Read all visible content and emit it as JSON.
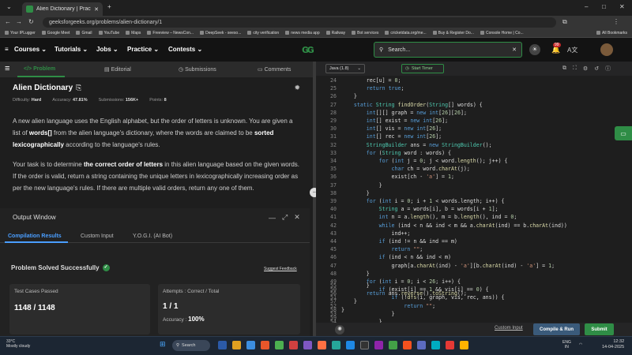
{
  "browser": {
    "tab_title": "Alien Dictionary | Practice | Gee...",
    "url": "geeksforgeeks.org/problems/alien-dictionary/1",
    "bookmarks": [
      "Your IPLugger",
      "Google Meet",
      "Gmail",
      "YouTube",
      "Maps",
      "Freeview – NewsCon...",
      "DeepSeek - seeso...",
      "city verification",
      "news media app",
      "Railway",
      "Bot services",
      "cricketdata.org/me...",
      "Buy & Register Do...",
      "Console Home | Co..."
    ],
    "all_bookmarks": "All Bookmarks"
  },
  "nav": {
    "items": [
      "Courses",
      "Tutorials",
      "Jobs",
      "Practice",
      "Contests"
    ],
    "search_placeholder": "Search...",
    "notif_count": "99"
  },
  "problem_tabs": [
    "Problem",
    "Editorial",
    "Submissions",
    "Comments"
  ],
  "problem": {
    "title": "Alien Dictionary",
    "difficulty_label": "Difficulty:",
    "difficulty": "Hard",
    "accuracy_label": "Accuracy:",
    "accuracy": "47.81%",
    "submissions_label": "Submissions:",
    "submissions": "156K+",
    "points_label": "Points:",
    "points": "8",
    "p1_a": "A new alien language uses the English alphabet, but the order of letters is unknown. You are given a list of ",
    "p1_b": "words[]",
    "p1_c": " from the alien language's dictionary, where the words are claimed to be ",
    "p1_d": "sorted lexicographically",
    "p1_e": " according to the language's rules.",
    "p2_a": "Your task is to determine ",
    "p2_b": "the correct order of letters",
    "p2_c": " in this alien language based on the given words. If the order is valid, return a string containing the unique letters in lexicographically increasing order as per the new language's rules. If there are multiple valid orders, return any one of them."
  },
  "output": {
    "title": "Output Window",
    "tabs": [
      "Compilation Results",
      "Custom Input",
      "Y.O.G.I. (AI Bot)"
    ],
    "status": "Problem Solved Successfully",
    "feedback": "Suggest Feedback",
    "tc_label": "Test Cases Passed",
    "tc_value": "1148 / 1148",
    "att_label": "Attempts : Correct / Total",
    "att_value": "1 / 1",
    "acc_label": "Accuracy :",
    "acc_value": "100%"
  },
  "editor": {
    "language": "Java (1.8)",
    "timer": "Start Timer",
    "custom_input": "Custom Input",
    "compile": "Compile & Run",
    "submit": "Submit"
  },
  "taskbar": {
    "temp": "33°C",
    "weather": "Mostly cloudy",
    "search": "Search",
    "lang1": "ENG",
    "lang2": "IN",
    "time": "12:32",
    "date": "14-04-2025"
  },
  "colors": {
    "accent": "#2f8d46",
    "bg": "#1e1e1e"
  }
}
